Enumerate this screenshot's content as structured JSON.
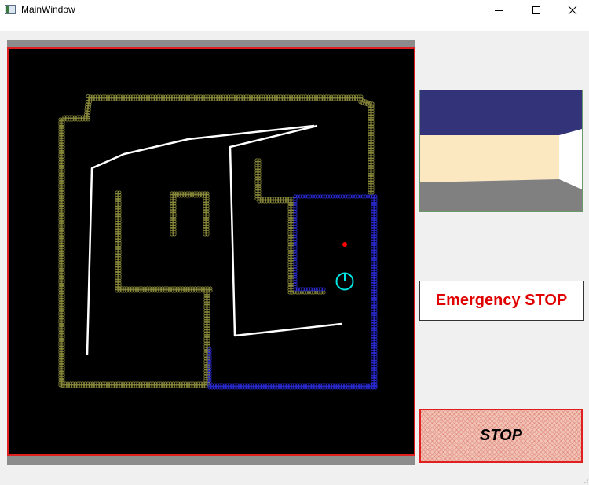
{
  "window": {
    "title": "MainWindow"
  },
  "controls": {
    "emergency_stop_label": "Emergency STOP",
    "stop_button_label": "STOP"
  },
  "colors": {
    "map_background": "#000000",
    "map_border": "#e02020",
    "obstacle_points": "#8a8a3c",
    "laser_points": "#2a2ad2",
    "robot_path": "#ffffff",
    "robot": "#00e5e5",
    "goal": "#ff0000",
    "emergency_text": "#e00000",
    "camera_ceiling": "#33337a",
    "camera_wall": "#fce8c0",
    "camera_floor": "#808080"
  }
}
